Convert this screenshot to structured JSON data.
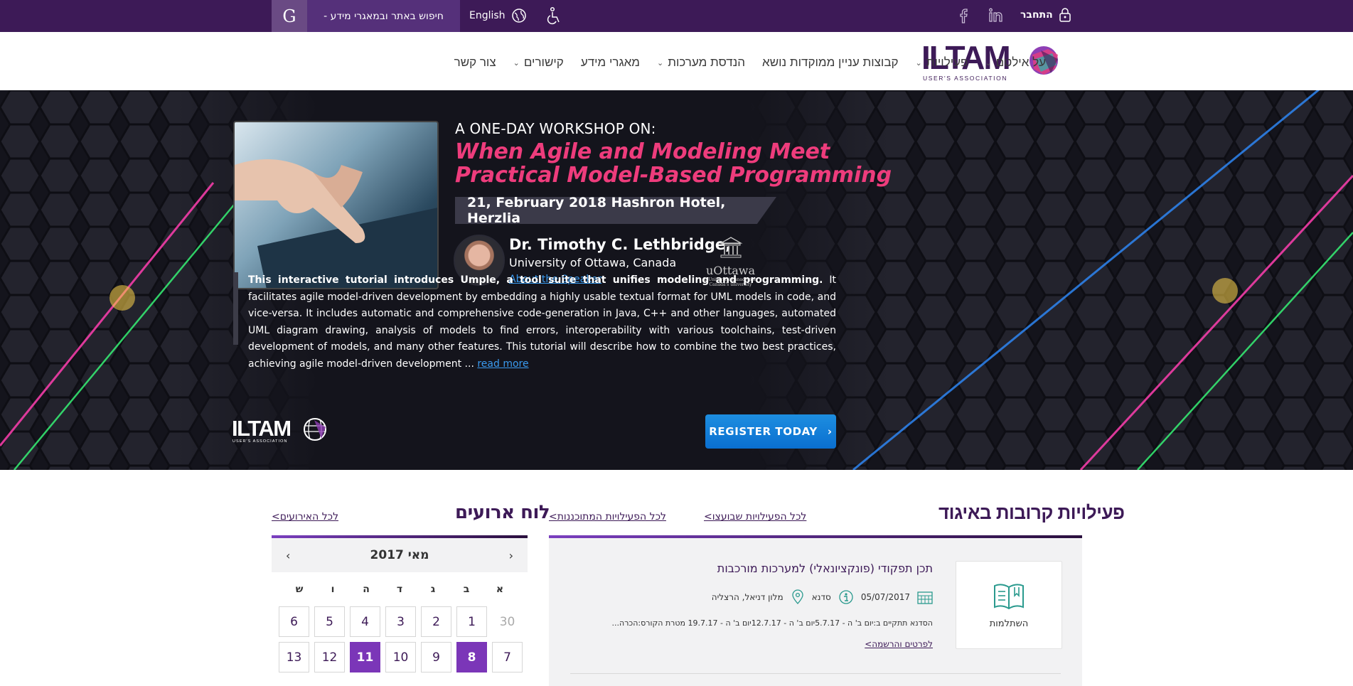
{
  "topbar": {
    "search_button": "G",
    "search_text": "חיפוש באתר ובמאגרי מידע -",
    "language": "English",
    "login": "התחבר",
    "social": [
      "facebook-icon",
      "linkedin-icon"
    ],
    "colors": {
      "bar": "#3d1a57",
      "search_bg": "#55307a"
    }
  },
  "nav": {
    "logo_text": "ILTAM",
    "logo_sub": "USER'S ASSOCIATION",
    "items": [
      {
        "label": "על אילטם",
        "dropdown": true
      },
      {
        "label": "פעילויות",
        "dropdown": true
      },
      {
        "label": "קבוצות עניין ממוקדות נושא",
        "dropdown": false
      },
      {
        "label": "הנדסת מערכות",
        "dropdown": true
      },
      {
        "label": "מאגרי מידע",
        "dropdown": false
      },
      {
        "label": "קישורים",
        "dropdown": true
      },
      {
        "label": "צור קשר",
        "dropdown": false
      }
    ]
  },
  "hero": {
    "kicker": "A ONE-DAY WORKSHOP ON:",
    "headline_line1": "When Agile and Modeling Meet",
    "headline_line2": "Practical Model-Based Programming",
    "date_venue": "21, February  2018 Hashron Hotel, Herzlia",
    "speaker_name": "Dr. Timothy C. Lethbridge,",
    "speaker_uni": "University of Ottawa, Canada",
    "speaker_link": "About the Speaker",
    "uottawa_name": "uOttawa",
    "uottawa_sub1": "L'Université canadienne",
    "uottawa_sub2": "Canada's university",
    "desc_bold": "This interactive tutorial introduces Umple, a tool suite that unifies modeling and programming.",
    "desc_rest": " It facilitates agile model-driven development by embedding a highly usable textual format for UML models in code, and vice-versa. It includes automatic and comprehensive code-generation in Java, C++ and other languages, automated UML diagram drawing, analysis of models to find errors, interoperability with various toolchains, test-driven development of models, and many other features. This tutorial will describe how to combine the two best practices, achieving agile model-driven development ... ",
    "read_more": "read more",
    "register": "REGISTER TODAY",
    "footer_logo": "ILTAM",
    "footer_logo_sub": "USER'S ASSOCIATION",
    "colors": {
      "headline": "#ee3c7c",
      "link": "#3a9bf0",
      "button": "#0a6fd0"
    }
  },
  "activities": {
    "title": "פעילויות קרובות באיגוד",
    "link_week": "לכל הפעילויות שבועצו>",
    "link_all": "לכל הפעילויות המתוכננות>",
    "card_label": "השתלמות",
    "item_title": "תכן תפקודי (פונקציונאלי) למערכות מורכבות",
    "date": "05/07/2017",
    "type": "סדנא",
    "location": "מלון דניאל, הרצליה",
    "desc": "הסדנא תתקיים ב:יום ב' ה - 5.7.17יום ב' ה - 12.7.17יום ב' ה - 19.7.17 מטרת הקורס:הכרה...",
    "details_link": "לפרטים והרשמה>"
  },
  "events": {
    "title": "לוח ארועים",
    "link_all": "לכל האירועים>",
    "month": "מאי 2017",
    "weekdays": [
      "א",
      "ב",
      "ג",
      "ד",
      "ה",
      "ו",
      "ש"
    ],
    "days": [
      {
        "n": "30",
        "state": "muted"
      },
      {
        "n": "1",
        "state": ""
      },
      {
        "n": "2",
        "state": ""
      },
      {
        "n": "3",
        "state": ""
      },
      {
        "n": "4",
        "state": ""
      },
      {
        "n": "5",
        "state": ""
      },
      {
        "n": "6",
        "state": ""
      },
      {
        "n": "7",
        "state": ""
      },
      {
        "n": "8",
        "state": "active"
      },
      {
        "n": "9",
        "state": ""
      },
      {
        "n": "10",
        "state": ""
      },
      {
        "n": "11",
        "state": "active"
      },
      {
        "n": "12",
        "state": ""
      },
      {
        "n": "13",
        "state": ""
      }
    ]
  }
}
